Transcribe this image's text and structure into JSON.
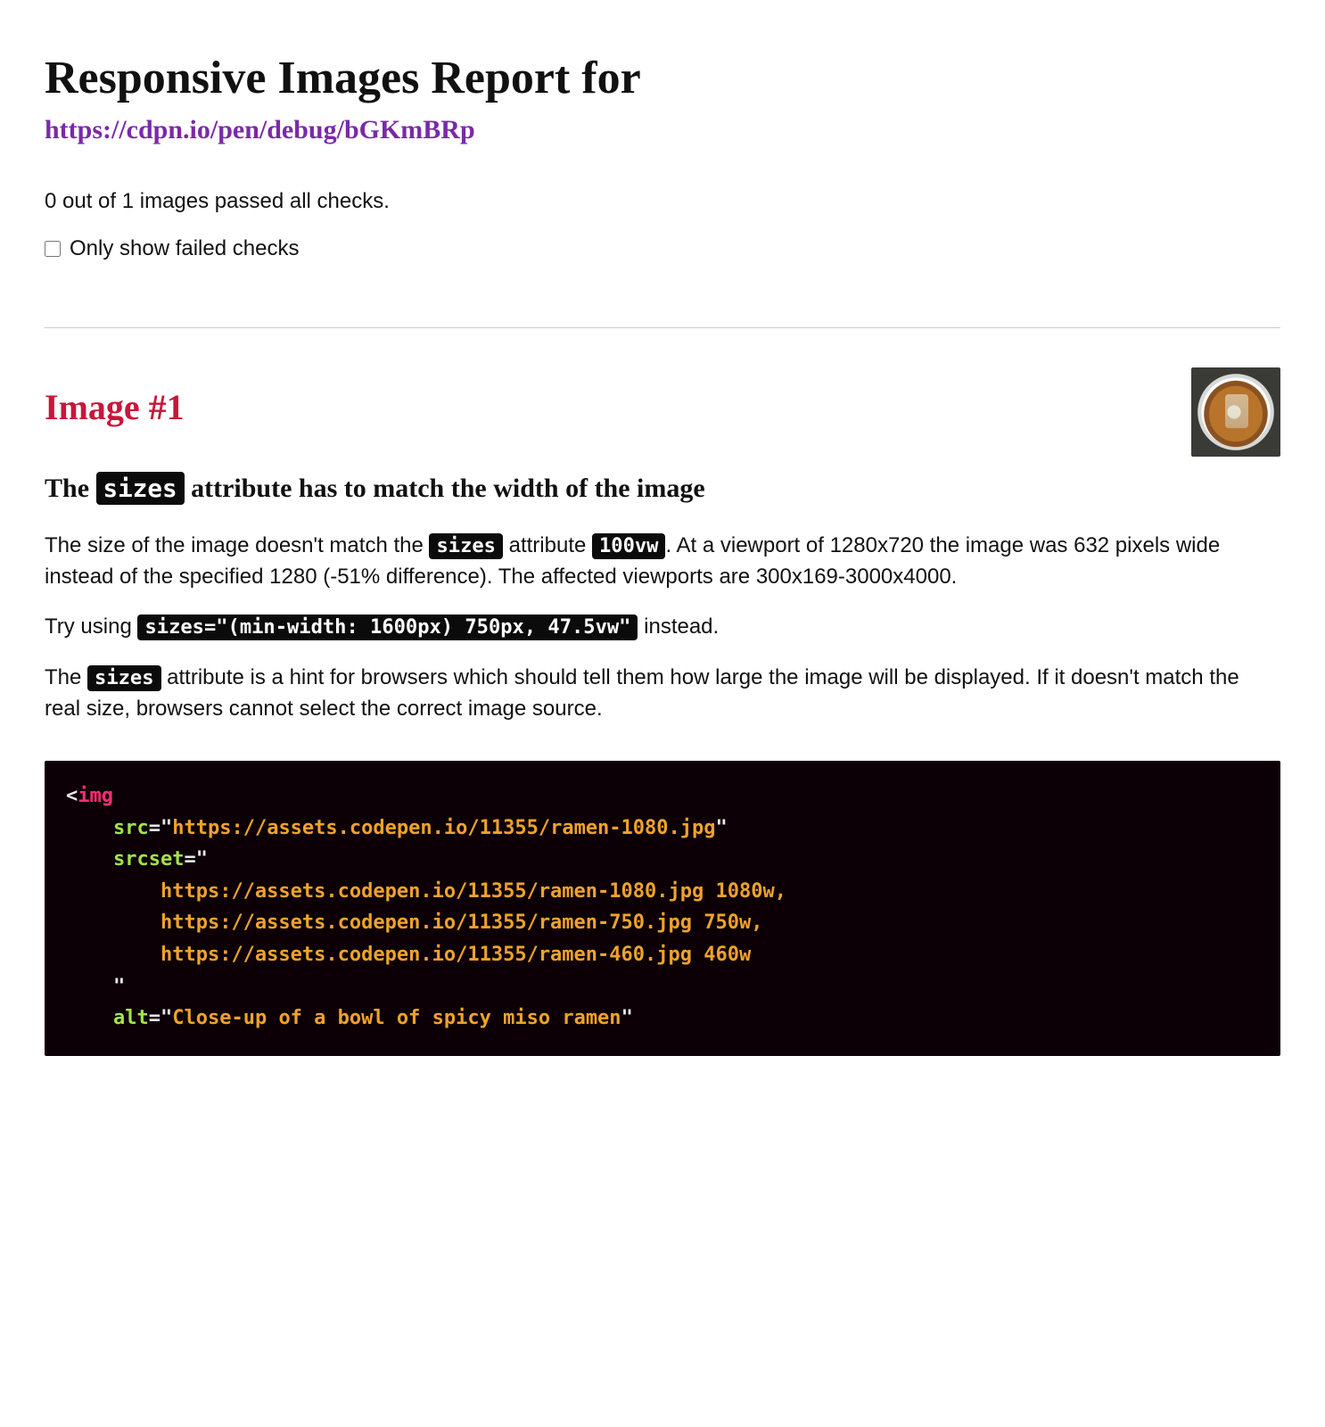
{
  "title": "Responsive Images Report for",
  "report_url": "https://cdpn.io/pen/debug/bGKmBRp",
  "summary": "0 out of 1 images passed all checks.",
  "filter_label": "Only show failed checks",
  "filter_checked": false,
  "image": {
    "heading": "Image #1",
    "rule_title_pre": "The ",
    "rule_title_code": "sizes",
    "rule_title_post": " attribute has to match the width of the image",
    "p1_a": "The size of the image doesn't match the ",
    "p1_code1": "sizes",
    "p1_b": " attribute ",
    "p1_code2": "100vw",
    "p1_c": ". At a viewport of 1280x720 the image was 632 pixels wide instead of the specified 1280 (-51% difference). The affected viewports are 300x169-3000x4000.",
    "p2_a": "Try using ",
    "p2_code": "sizes=\"(min-width: 1600px) 750px, 47.5vw\"",
    "p2_b": " instead.",
    "p3_a": "The ",
    "p3_code": "sizes",
    "p3_b": " attribute is a hint for browsers which should tell them how large the image will be displayed. If it doesn't match the real size, browsers cannot select the correct image source."
  },
  "code": {
    "tag": "img",
    "attrs": {
      "src": "https://assets.codepen.io/11355/ramen-1080.jpg",
      "srcset_lines": [
        {
          "url": "https://assets.codepen.io/11355/ramen-1080.jpg",
          "w": "1080w",
          "comma": ","
        },
        {
          "url": "https://assets.codepen.io/11355/ramen-750.jpg",
          "w": "750w",
          "comma": ","
        },
        {
          "url": "https://assets.codepen.io/11355/ramen-460.jpg",
          "w": "460w",
          "comma": ""
        }
      ],
      "alt": "Close-up of a bowl of spicy miso ramen"
    }
  }
}
